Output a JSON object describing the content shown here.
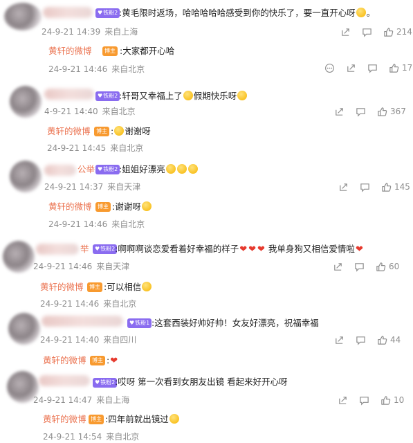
{
  "comments": [
    {
      "badge": "铁粉2",
      "text_before": ":黄毛限时返场，哈哈哈哈哈感受到你的快乐了，要一直开心呀",
      "text_after": "。",
      "time": "24-9-21 14:39",
      "location": "来自上海",
      "likes": "214",
      "reply": {
        "name": "黄轩的微博",
        "level": "博主",
        "text": ":大家都开心哈",
        "time": "24-9-21 14:46",
        "location": "来自北京",
        "likes": "17"
      }
    },
    {
      "badge": "铁粉2",
      "text_before": ":轩哥又幸福上了",
      "text_mid": "假期快乐呀",
      "text_after": "",
      "time": "4-9-21 14:40",
      "location": "来自北京",
      "likes": "367",
      "reply": {
        "name": "黄轩的微博",
        "level": "博主",
        "text": ":",
        "text2": "谢谢呀",
        "time": "24-9-21 14:45",
        "location": "来自北京"
      }
    },
    {
      "name_partial": "公举",
      "badge": "铁粉2",
      "text_before": ":姐姐好漂亮",
      "time": "24-9-21 14:37",
      "location": "来自天津",
      "likes": "145",
      "reply": {
        "name": "黄轩的微博",
        "level": "博主",
        "text": ":谢谢呀",
        "time": "24-9-21 14:46",
        "location": "来自北京"
      }
    },
    {
      "name_partial": "举",
      "badge": "铁粉2",
      "text_before": ":啊啊啊谈恋爱看着好幸福的样子",
      "text_mid": "我单身狗又相信爱情啦",
      "time": "24-9-21 14:46",
      "location": "来自天津",
      "likes": "60",
      "reply": {
        "name": "黄轩的微博",
        "level": "博主",
        "text": ":可以相信",
        "time": "24-9-21 14:46",
        "location": "来自北京"
      }
    },
    {
      "badge": "铁粉1",
      "text_before": ":这套西装好帅好帅！女友好漂亮，祝福幸福",
      "time": "24-9-21 14:40",
      "location": "来自四川",
      "likes": "44",
      "reply": {
        "name": "黄轩的微博",
        "level": "博主",
        "text": ":"
      }
    },
    {
      "badge": "铁粉2",
      "text_before": ":哎呀 第一次看到女朋友出镜 看起来好开心呀",
      "time": "24-9-21 14:47",
      "location": "来自上海",
      "likes": "10",
      "reply": {
        "name": "黄轩的微博",
        "level": "博主",
        "text": ":四年前就出镜过",
        "time": "24-9-21 14:54",
        "location": "来自北京"
      }
    }
  ],
  "colors": {
    "reply_name": "#eb7350",
    "badge_fan": "#8a6cf0",
    "badge_host": "#f89a2f",
    "meta": "#8e8e8e"
  }
}
